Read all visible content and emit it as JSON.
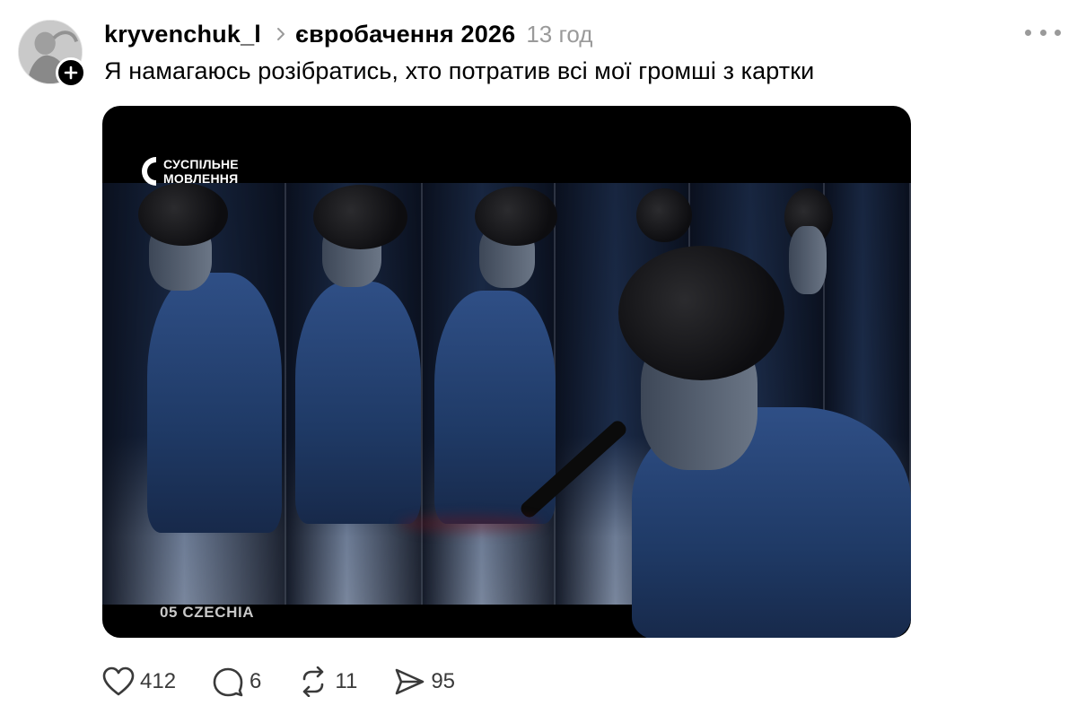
{
  "post": {
    "username": "kryvenchuk_l",
    "topic": "євробачення 2026",
    "time": "13 год",
    "caption": "Я намагаюсь розібратись, хто потратив всі мої громші з картки"
  },
  "media": {
    "brand_line1": "СУСПІЛЬНЕ",
    "brand_line2": "МОВЛЕННЯ",
    "country_label": "05 CZECHIA"
  },
  "actions": {
    "likes": "412",
    "replies": "6",
    "reposts": "11",
    "shares": "95"
  },
  "icons": {
    "like": "heart-icon",
    "reply": "comment-icon",
    "repost": "repost-icon",
    "share": "send-icon",
    "more": "more-icon",
    "follow": "plus-icon",
    "separator": "chevron-right-icon"
  },
  "colors": {
    "text": "#000000",
    "muted": "#9a9a9a",
    "count": "#3a3a3a"
  }
}
